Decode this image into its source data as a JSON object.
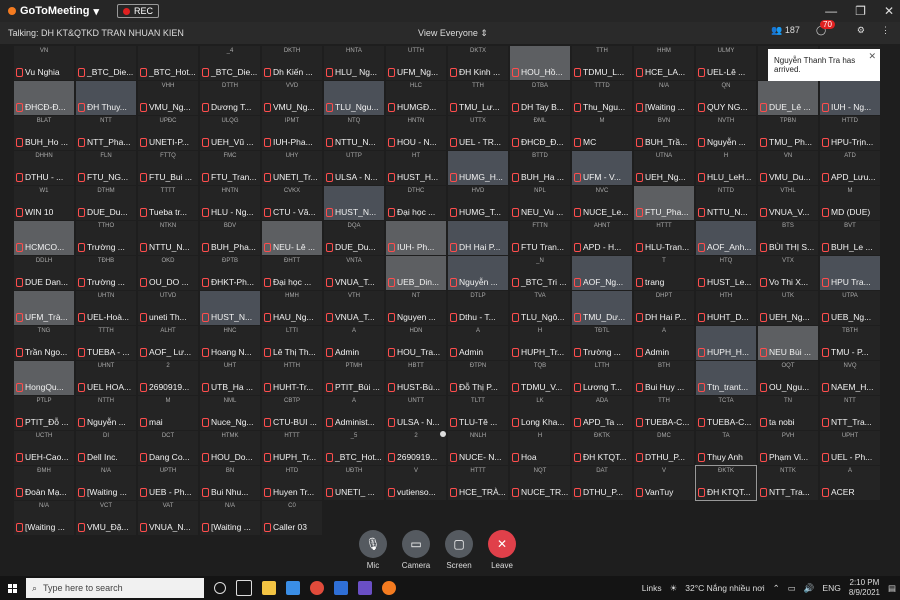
{
  "app": {
    "title": "GoToMeeting",
    "rec_label": "REC"
  },
  "window_controls": {
    "minimize": "—",
    "restore": "❐",
    "close": "✕"
  },
  "infobar": {
    "talking": "Talking: DH KT&QTKD TRAN NHUAN KIEN",
    "view": "View Everyone",
    "attendees": "187",
    "chat_count": "70"
  },
  "notification": {
    "text": "Nguyễn Thanh Tra has arrived.",
    "close": "✕"
  },
  "tiles": [
    {
      "top": "VN",
      "name": "Vu Nghia",
      "video": false
    },
    {
      "top": "",
      "name": "_BTC_Die...",
      "video": false
    },
    {
      "top": "",
      "name": "_BTC_Hot...",
      "video": false
    },
    {
      "top": "_4",
      "name": "_BTC_Die...",
      "video": false
    },
    {
      "top": "DKTH",
      "name": "Dh Kiến ...",
      "video": false
    },
    {
      "top": "HNTA",
      "name": "HLU_ Ng...",
      "video": false
    },
    {
      "top": "UTTH",
      "name": "UFM_Ng...",
      "video": false
    },
    {
      "top": "DKTX",
      "name": "ĐH Kinh ...",
      "video": false
    },
    {
      "top": "",
      "name": "HOU_Hồ...",
      "video": true
    },
    {
      "top": "TTH",
      "name": "TDMU_L...",
      "video": false
    },
    {
      "top": "HHM",
      "name": "HCE_LA...",
      "video": false
    },
    {
      "top": "ULMY",
      "name": "UEL-Lê ...",
      "video": false
    },
    {
      "top": "",
      "name": "",
      "video": false
    },
    {
      "top": "",
      "name": "",
      "video": false
    },
    {
      "top": "",
      "name": "ĐHCĐ-Đ...",
      "video": true
    },
    {
      "top": "",
      "name": "ĐH Thuy...",
      "video": true
    },
    {
      "top": "VHH",
      "name": "VMU_Ng...",
      "video": false
    },
    {
      "top": "DTTH",
      "name": "Dương T...",
      "video": false
    },
    {
      "top": "VVD",
      "name": "VMU_Ng...",
      "video": false
    },
    {
      "top": "",
      "name": "TLU_Ngu...",
      "video": true
    },
    {
      "top": "HLC",
      "name": "HUMGĐ...",
      "video": false
    },
    {
      "top": "TTH",
      "name": "TMU_Lư...",
      "video": false
    },
    {
      "top": "DTBA",
      "name": "DH Tay B...",
      "video": false
    },
    {
      "top": "TTTD",
      "name": "Thu_Ngu...",
      "video": false
    },
    {
      "top": "N/A",
      "name": "[Waiting ...",
      "video": false
    },
    {
      "top": "QN",
      "name": "QUY NG...",
      "video": false
    },
    {
      "top": "",
      "name": "DUE_Lê ...",
      "video": true
    },
    {
      "top": "",
      "name": "IUH - Ng...",
      "video": true
    },
    {
      "top": "BLAT",
      "name": "BUH_Ho ...",
      "video": false
    },
    {
      "top": "NTT",
      "name": "NTT_Pha...",
      "video": false
    },
    {
      "top": "UPĐC",
      "name": "UNETI-P...",
      "video": false
    },
    {
      "top": "ULQG",
      "name": "UEH_Vũ ...",
      "video": false
    },
    {
      "top": "IPMT",
      "name": "IUH-Pha...",
      "video": false
    },
    {
      "top": "NTQ",
      "name": "NTTU_N...",
      "video": false
    },
    {
      "top": "HNTN",
      "name": "HOU - N...",
      "video": false
    },
    {
      "top": "UTTX",
      "name": "UEL - TR...",
      "video": false
    },
    {
      "top": "ĐML",
      "name": "ĐHCĐ_Đ...",
      "video": false
    },
    {
      "top": "M",
      "name": "MC",
      "video": false
    },
    {
      "top": "BVN",
      "name": "BUH_Trầ...",
      "video": false
    },
    {
      "top": "NVTH",
      "name": "Nguyễn ...",
      "video": false
    },
    {
      "top": "TPBN",
      "name": "TMU_ Ph...",
      "video": false
    },
    {
      "top": "HTTD",
      "name": "HPU-Trịn...",
      "video": false
    },
    {
      "top": "DHHN",
      "name": "DTHU - ...",
      "video": false
    },
    {
      "top": "FLN",
      "name": "FTU_NG...",
      "video": false
    },
    {
      "top": "FTTQ",
      "name": "FTU_Bui ...",
      "video": false
    },
    {
      "top": "FMC",
      "name": "FTU_Tran...",
      "video": false
    },
    {
      "top": "UHY",
      "name": "UNETI_Tr...",
      "video": false
    },
    {
      "top": "UTTP",
      "name": "ULSA - N...",
      "video": false
    },
    {
      "top": "HT",
      "name": "HUST_H...",
      "video": false
    },
    {
      "top": "",
      "name": "HUMG_H...",
      "video": true
    },
    {
      "top": "BTTD",
      "name": "BUH_Ha ...",
      "video": false
    },
    {
      "top": "",
      "name": "UFM - V...",
      "video": true
    },
    {
      "top": "UTNA",
      "name": "UEH_Ng...",
      "video": false
    },
    {
      "top": "H",
      "name": "HLU_LeH...",
      "video": false
    },
    {
      "top": "VN",
      "name": "VMU_Du...",
      "video": false
    },
    {
      "top": "ATD",
      "name": "APD_Lưu...",
      "video": false
    },
    {
      "top": "W1",
      "name": "WIN 10",
      "video": false
    },
    {
      "top": "DTHM",
      "name": "DUE_Du...",
      "video": false
    },
    {
      "top": "TTTT",
      "name": "Tueba tr...",
      "video": false
    },
    {
      "top": "HNTN",
      "name": "HLU - Ng...",
      "video": false
    },
    {
      "top": "CVKX",
      "name": "CTU - Vă...",
      "video": false
    },
    {
      "top": "",
      "name": "HUST_N...",
      "video": true
    },
    {
      "top": "DTHC",
      "name": "Đại học ...",
      "video": false
    },
    {
      "top": "HVD",
      "name": "HUMG_T...",
      "video": false
    },
    {
      "top": "NPL",
      "name": "NEU_Vu ...",
      "video": false
    },
    {
      "top": "NVC",
      "name": "NUCE_Le...",
      "video": false
    },
    {
      "top": "",
      "name": "FTU_Pha...",
      "video": true
    },
    {
      "top": "NTTD",
      "name": "NTTU_N...",
      "video": false
    },
    {
      "top": "VTHL",
      "name": "VNUA_V...",
      "video": false
    },
    {
      "top": "M",
      "name": "MD (DUE)",
      "video": false
    },
    {
      "top": "",
      "name": "HCMCO...",
      "video": true
    },
    {
      "top": "TTHO",
      "name": "Trường ...",
      "video": false
    },
    {
      "top": "NTKN",
      "name": "NTTU_N...",
      "video": false
    },
    {
      "top": "BDV",
      "name": "BUH_Pha...",
      "video": false
    },
    {
      "top": "",
      "name": "NEU- Lê ...",
      "video": true
    },
    {
      "top": "DQA",
      "name": "DUE_Du...",
      "video": false
    },
    {
      "top": "",
      "name": "IUH- Ph...",
      "video": true
    },
    {
      "top": "",
      "name": "DH Hai P...",
      "video": true
    },
    {
      "top": "FTTN",
      "name": "FTU Tran...",
      "video": false
    },
    {
      "top": "AHNT",
      "name": "APD - H...",
      "video": false
    },
    {
      "top": "HTTT",
      "name": "HLU-Tran...",
      "video": false
    },
    {
      "top": "",
      "name": "AOF_Anh...",
      "video": true
    },
    {
      "top": "BTS",
      "name": "BÙI THỊ S...",
      "video": false
    },
    {
      "top": "BVT",
      "name": "BUH_Le ...",
      "video": false
    },
    {
      "top": "DDLH",
      "name": "DUE Dan...",
      "video": false
    },
    {
      "top": "TĐHB",
      "name": "Trường ...",
      "video": false
    },
    {
      "top": "OKD",
      "name": "OU_DO ...",
      "video": false
    },
    {
      "top": "ĐPTB",
      "name": "ĐHKT-Ph...",
      "video": false
    },
    {
      "top": "ĐHTT",
      "name": "Đại học ...",
      "video": false
    },
    {
      "top": "VNTA",
      "name": "VNUA_T...",
      "video": false
    },
    {
      "top": "",
      "name": "UEB_Din...",
      "video": true
    },
    {
      "top": "",
      "name": "Nguyễn ...",
      "video": true
    },
    {
      "top": "_N",
      "name": "_BTC_Tri ...",
      "video": false
    },
    {
      "top": "",
      "name": "AOF_Ng...",
      "video": true
    },
    {
      "top": "T",
      "name": "trang",
      "video": false
    },
    {
      "top": "HTQ",
      "name": "HUST_Le...",
      "video": false
    },
    {
      "top": "VTX",
      "name": "Vo Thi X...",
      "video": false
    },
    {
      "top": "",
      "name": "HPU Tra...",
      "video": true
    },
    {
      "top": "",
      "name": "UFM_Trà...",
      "video": true
    },
    {
      "top": "UHTN",
      "name": "UEL-Hoà...",
      "video": false
    },
    {
      "top": "UTVD",
      "name": "uneti Th...",
      "video": false
    },
    {
      "top": "",
      "name": "HUST_N...",
      "video": true
    },
    {
      "top": "HMH",
      "name": "HAU_Ng...",
      "video": false
    },
    {
      "top": "VTH",
      "name": "VNUA_T...",
      "video": false
    },
    {
      "top": "NT",
      "name": "Nguyen ...",
      "video": false
    },
    {
      "top": "DTLP",
      "name": "Dthu - T...",
      "video": false
    },
    {
      "top": "TVA",
      "name": "TLU_Ngô...",
      "video": false
    },
    {
      "top": "",
      "name": "TMU_Dư...",
      "video": true
    },
    {
      "top": "DHPT",
      "name": "DH Hai P...",
      "video": false
    },
    {
      "top": "HTH",
      "name": "HUHT_D...",
      "video": false
    },
    {
      "top": "UTK",
      "name": "UEH_Ng...",
      "video": false
    },
    {
      "top": "UTPA",
      "name": "UEB_Ng...",
      "video": false
    },
    {
      "top": "TNG",
      "name": "Trần Ngo...",
      "video": false
    },
    {
      "top": "TTTH",
      "name": "TUEBA - ...",
      "video": false
    },
    {
      "top": "ALHT",
      "name": "AOF_ Lư...",
      "video": false
    },
    {
      "top": "HNC",
      "name": "Hoang N...",
      "video": false
    },
    {
      "top": "LTTI",
      "name": "Lê Thị Th...",
      "video": false
    },
    {
      "top": "A",
      "name": "Admin",
      "video": false
    },
    {
      "top": "HDN",
      "name": "HOU_Tra...",
      "video": false
    },
    {
      "top": "A",
      "name": "Admin",
      "video": false
    },
    {
      "top": "H",
      "name": "HUPH_Tr...",
      "video": false
    },
    {
      "top": "TĐTL",
      "name": "Trường ...",
      "video": false
    },
    {
      "top": "A",
      "name": "Admin",
      "video": false
    },
    {
      "top": "",
      "name": "HUPH_H...",
      "video": true
    },
    {
      "top": "",
      "name": "NEU Bùi ...",
      "video": true
    },
    {
      "top": "TBTH",
      "name": "TMU - P...",
      "video": false
    },
    {
      "top": "",
      "name": "HongQu...",
      "video": true
    },
    {
      "top": "UHNT",
      "name": "UEL HOA...",
      "video": false
    },
    {
      "top": "2",
      "name": "2690919...",
      "video": false
    },
    {
      "top": "UHT",
      "name": "UTB_Ha ...",
      "video": false
    },
    {
      "top": "HTTH",
      "name": "HUHT-Tr...",
      "video": false
    },
    {
      "top": "PTMH",
      "name": "PTIT_Bùi ...",
      "video": false
    },
    {
      "top": "HBTT",
      "name": "HUST-Bù...",
      "video": false
    },
    {
      "top": "ĐTPN",
      "name": "Đỗ Thị P...",
      "video": false
    },
    {
      "top": "TQB",
      "name": "TDMU_V...",
      "video": false
    },
    {
      "top": "LTTH",
      "name": "Lương T...",
      "video": false
    },
    {
      "top": "BTH",
      "name": "Bui Huy ...",
      "video": false
    },
    {
      "top": "",
      "name": "Ttn_trant...",
      "video": true
    },
    {
      "top": "OQT",
      "name": "OU_Ngu...",
      "video": false
    },
    {
      "top": "NVQ",
      "name": "NAEM_H...",
      "video": false
    },
    {
      "top": "PTLP",
      "name": "PTIT_Đỗ ...",
      "video": false
    },
    {
      "top": "NTTH",
      "name": "Nguyễn ...",
      "video": false
    },
    {
      "top": "M",
      "name": "mai",
      "video": false
    },
    {
      "top": "NML",
      "name": "Nuce_Ng...",
      "video": false
    },
    {
      "top": "CBTP",
      "name": "CTU-BUI ...",
      "video": false
    },
    {
      "top": "A",
      "name": "Administ...",
      "video": false
    },
    {
      "top": "UNTT",
      "name": "ULSA - N...",
      "video": false
    },
    {
      "top": "TLTT",
      "name": "TLU-Tê ...",
      "video": false
    },
    {
      "top": "LK",
      "name": "Long Kha...",
      "video": false
    },
    {
      "top": "ADA",
      "name": "APD_Ta ...",
      "video": false
    },
    {
      "top": "TTH",
      "name": "TUEBA-C...",
      "video": false
    },
    {
      "top": "TCTA",
      "name": "TUEBA-C...",
      "video": false
    },
    {
      "top": "TN",
      "name": "ta nobi",
      "video": false
    },
    {
      "top": "NTT",
      "name": "NTT_Tra...",
      "video": false
    },
    {
      "top": "UCTH",
      "name": "UEH-Cao...",
      "video": false
    },
    {
      "top": "DI",
      "name": "Dell Inc.",
      "video": false
    },
    {
      "top": "DCT",
      "name": "Dang Co...",
      "video": false
    },
    {
      "top": "HTMK",
      "name": "HOU_Do...",
      "video": false
    },
    {
      "top": "HTTT",
      "name": "HUPH_Tr...",
      "video": false
    },
    {
      "top": "_5",
      "name": "_BTC_Hot...",
      "video": false
    },
    {
      "top": "2",
      "name": "2690919...",
      "video": false
    },
    {
      "top": "NNLH",
      "name": "NUCE- N...",
      "video": false
    },
    {
      "top": "H",
      "name": "Hoa",
      "video": false
    },
    {
      "top": "ĐKTK",
      "name": "ĐH KTQT...",
      "video": false
    },
    {
      "top": "DMC",
      "name": "DTHU_P...",
      "video": false
    },
    {
      "top": "TA",
      "name": "Thuy Anh",
      "video": false
    },
    {
      "top": "PVH",
      "name": "Phạm Vi...",
      "video": false
    },
    {
      "top": "UPHT",
      "name": "UEL - Ph...",
      "video": false
    },
    {
      "top": "ĐMH",
      "name": "Đoàn Mạ...",
      "video": false
    },
    {
      "top": "N/A",
      "name": "[Waiting ...",
      "video": false
    },
    {
      "top": "UPTH",
      "name": "UEB - Ph...",
      "video": false
    },
    {
      "top": "BN",
      "name": "Bui Nhu...",
      "video": false
    },
    {
      "top": "HTD",
      "name": "Huyen Tr...",
      "video": false
    },
    {
      "top": "UĐTH",
      "name": "UNETI_ ...",
      "video": false
    },
    {
      "top": "V",
      "name": "vutienso...",
      "video": false
    },
    {
      "top": "HTTT",
      "name": "HCE_TRÀ...",
      "video": false
    },
    {
      "top": "NQT",
      "name": "NUCE_TR...",
      "video": false
    },
    {
      "top": "DAT",
      "name": "DTHU_P...",
      "video": false
    },
    {
      "top": "V",
      "name": "VanTuy",
      "video": false
    },
    {
      "top": "ĐKTK",
      "name": "ĐH KTQT...",
      "video": false,
      "selected": true
    },
    {
      "top": "NTTK",
      "name": "NTT_Tra...",
      "video": false
    },
    {
      "top": "A",
      "name": "ACER",
      "video": false
    },
    {
      "top": "N/A",
      "name": "[Waiting ...",
      "video": false
    },
    {
      "top": "VCT",
      "name": "VMU_Đặ...",
      "video": false
    },
    {
      "top": "VAT",
      "name": "VNUA_N...",
      "video": false
    },
    {
      "top": "N/A",
      "name": "[Waiting ...",
      "video": false
    },
    {
      "top": "C0",
      "name": "Caller 03",
      "video": false
    }
  ],
  "controls": {
    "mic": "Mic",
    "camera": "Camera",
    "screen": "Screen",
    "leave": "Leave"
  },
  "taskbar": {
    "search_placeholder": "Type here to search",
    "links": "Links",
    "weather": "32°C  Nắng nhiều nơi",
    "lang": "ENG",
    "time": "2:10 PM",
    "date": "8/9/2021"
  }
}
